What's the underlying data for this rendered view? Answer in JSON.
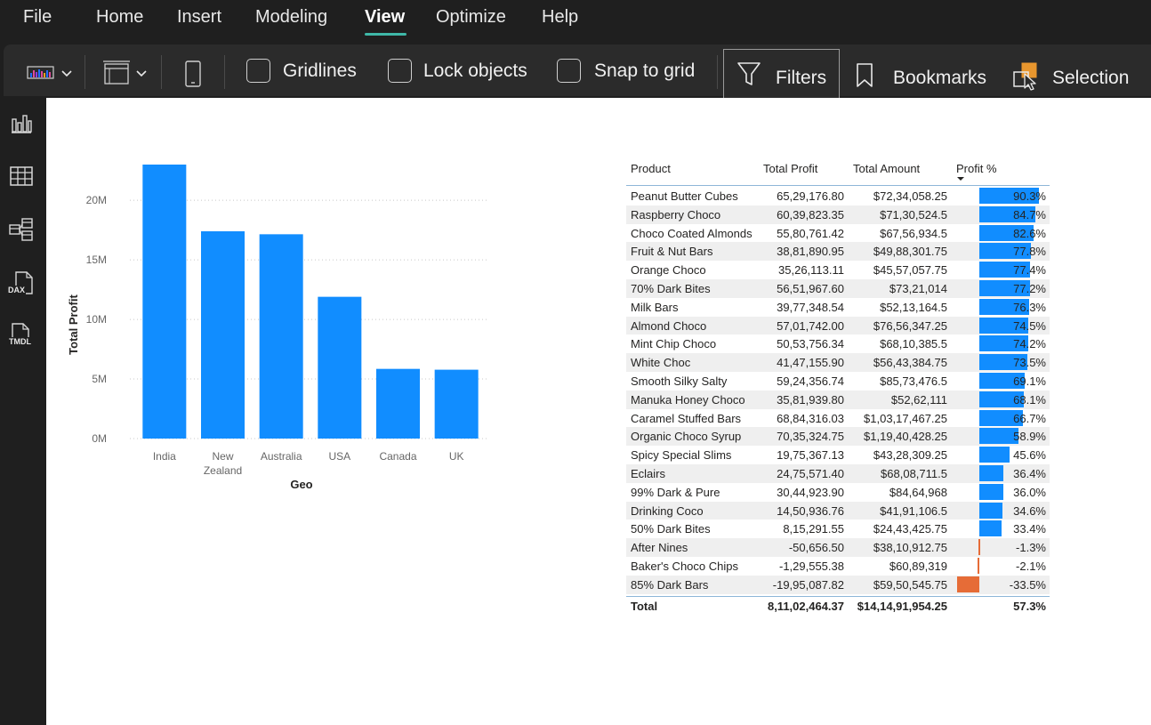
{
  "menu": {
    "items": [
      "File",
      "Home",
      "Insert",
      "Modeling",
      "View",
      "Optimize",
      "Help"
    ],
    "active": "View"
  },
  "ribbon": {
    "gridlines_label": "Gridlines",
    "lock_label": "Lock objects",
    "snap_label": "Snap to grid",
    "filters_label": "Filters",
    "bookmarks_label": "Bookmarks",
    "selection_label": "Selection"
  },
  "leftrail": {
    "dax_label": "DAX",
    "tmdl_label": "TMDL"
  },
  "colors": {
    "bar": "#118DFF",
    "negative_bar": "#E66C37",
    "accent": "#3fb8a8"
  },
  "chart_data": {
    "type": "bar",
    "categories": [
      "India",
      "New Zealand",
      "Australia",
      "USA",
      "Canada",
      "UK"
    ],
    "category_labels": [
      [
        "India"
      ],
      [
        "New",
        "Zealand"
      ],
      [
        "Australia"
      ],
      [
        "USA"
      ],
      [
        "Canada"
      ],
      [
        "UK"
      ]
    ],
    "values": [
      23000000,
      17400000,
      17150000,
      11900000,
      5850000,
      5780000
    ],
    "ylabel": "Total Profit",
    "xlabel": "Geo",
    "ylim": [
      0,
      23000000
    ],
    "yticks": [
      0,
      5000000,
      10000000,
      15000000,
      20000000
    ],
    "ytick_labels": [
      "0M",
      "5M",
      "10M",
      "15M",
      "20M"
    ],
    "grid": true
  },
  "table": {
    "headers": [
      "Product",
      "Total Profit",
      "Total Amount",
      "Profit %"
    ],
    "sort_column": "Profit %",
    "rows": [
      {
        "product": "Peanut Butter Cubes",
        "profit": "65,29,176.80",
        "amount": "$72,34,058.25",
        "pct": "90.3%",
        "pct_value": 90.3
      },
      {
        "product": "Raspberry Choco",
        "profit": "60,39,823.35",
        "amount": "$71,30,524.5",
        "pct": "84.7%",
        "pct_value": 84.7
      },
      {
        "product": "Choco Coated Almonds",
        "profit": "55,80,761.42",
        "amount": "$67,56,934.5",
        "pct": "82.6%",
        "pct_value": 82.6
      },
      {
        "product": "Fruit & Nut Bars",
        "profit": "38,81,890.95",
        "amount": "$49,88,301.75",
        "pct": "77.8%",
        "pct_value": 77.8
      },
      {
        "product": "Orange Choco",
        "profit": "35,26,113.11",
        "amount": "$45,57,057.75",
        "pct": "77.4%",
        "pct_value": 77.4
      },
      {
        "product": "70% Dark Bites",
        "profit": "56,51,967.60",
        "amount": "$73,21,014",
        "pct": "77.2%",
        "pct_value": 77.2
      },
      {
        "product": "Milk Bars",
        "profit": "39,77,348.54",
        "amount": "$52,13,164.5",
        "pct": "76.3%",
        "pct_value": 76.3
      },
      {
        "product": "Almond Choco",
        "profit": "57,01,742.00",
        "amount": "$76,56,347.25",
        "pct": "74.5%",
        "pct_value": 74.5
      },
      {
        "product": "Mint Chip Choco",
        "profit": "50,53,756.34",
        "amount": "$68,10,385.5",
        "pct": "74.2%",
        "pct_value": 74.2
      },
      {
        "product": "White Choc",
        "profit": "41,47,155.90",
        "amount": "$56,43,384.75",
        "pct": "73.5%",
        "pct_value": 73.5
      },
      {
        "product": "Smooth Silky Salty",
        "profit": "59,24,356.74",
        "amount": "$85,73,476.5",
        "pct": "69.1%",
        "pct_value": 69.1
      },
      {
        "product": "Manuka Honey Choco",
        "profit": "35,81,939.80",
        "amount": "$52,62,111",
        "pct": "68.1%",
        "pct_value": 68.1
      },
      {
        "product": "Caramel Stuffed Bars",
        "profit": "68,84,316.03",
        "amount": "$1,03,17,467.25",
        "pct": "66.7%",
        "pct_value": 66.7
      },
      {
        "product": "Organic Choco Syrup",
        "profit": "70,35,324.75",
        "amount": "$1,19,40,428.25",
        "pct": "58.9%",
        "pct_value": 58.9
      },
      {
        "product": "Spicy Special Slims",
        "profit": "19,75,367.13",
        "amount": "$43,28,309.25",
        "pct": "45.6%",
        "pct_value": 45.6
      },
      {
        "product": "Eclairs",
        "profit": "24,75,571.40",
        "amount": "$68,08,711.5",
        "pct": "36.4%",
        "pct_value": 36.4
      },
      {
        "product": "99% Dark & Pure",
        "profit": "30,44,923.90",
        "amount": "$84,64,968",
        "pct": "36.0%",
        "pct_value": 36.0
      },
      {
        "product": "Drinking Coco",
        "profit": "14,50,936.76",
        "amount": "$41,91,106.5",
        "pct": "34.6%",
        "pct_value": 34.6
      },
      {
        "product": "50% Dark Bites",
        "profit": "8,15,291.55",
        "amount": "$24,43,425.75",
        "pct": "33.4%",
        "pct_value": 33.4
      },
      {
        "product": "After Nines",
        "profit": "-50,656.50",
        "amount": "$38,10,912.75",
        "pct": "-1.3%",
        "pct_value": -1.3
      },
      {
        "product": "Baker's Choco Chips",
        "profit": "-1,29,555.38",
        "amount": "$60,89,319",
        "pct": "-2.1%",
        "pct_value": -2.1
      },
      {
        "product": "85% Dark Bars",
        "profit": "-19,95,087.82",
        "amount": "$59,50,545.75",
        "pct": "-33.5%",
        "pct_value": -33.5
      }
    ],
    "total": {
      "product": "Total",
      "profit": "8,11,02,464.37",
      "amount": "$14,14,91,954.25",
      "pct": "57.3%"
    }
  }
}
